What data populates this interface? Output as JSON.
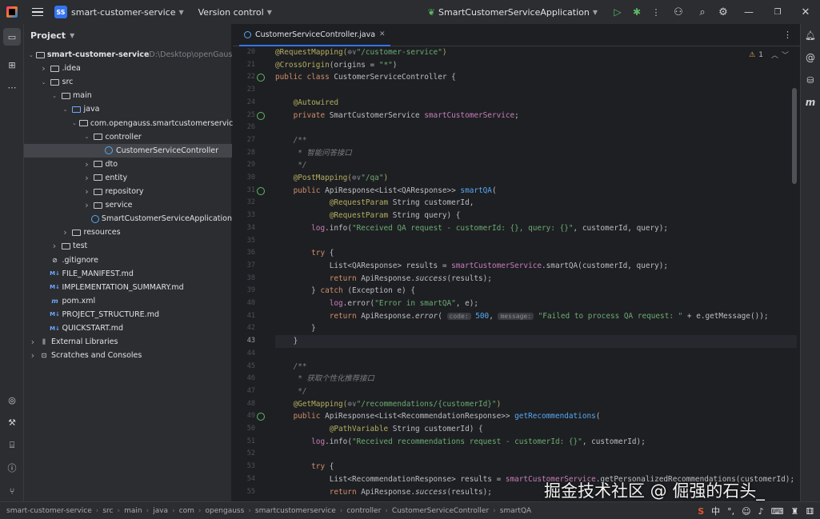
{
  "titlebar": {
    "project_badge": "SS",
    "project_name": "smart-customer-service",
    "vcs": "Version control",
    "run_config": "SmartCustomerServiceApplication"
  },
  "panel": {
    "title": "Project"
  },
  "tree": [
    {
      "depth": 0,
      "arrow": "open",
      "icon": "folder",
      "label": "smart-customer-service",
      "extra": "D:\\Desktop\\openGauss",
      "bold": true
    },
    {
      "depth": 1,
      "arrow": "closed",
      "icon": "folder",
      "label": ".idea"
    },
    {
      "depth": 1,
      "arrow": "open",
      "icon": "folder",
      "label": "src"
    },
    {
      "depth": 2,
      "arrow": "open",
      "icon": "folder",
      "label": "main"
    },
    {
      "depth": 3,
      "arrow": "open",
      "icon": "folder-blue",
      "label": "java"
    },
    {
      "depth": 4,
      "arrow": "open",
      "icon": "folder",
      "label": "com.opengauss.smartcustomerservice"
    },
    {
      "depth": 5,
      "arrow": "open",
      "icon": "folder",
      "label": "controller"
    },
    {
      "depth": 6,
      "arrow": "none",
      "icon": "class",
      "label": "CustomerServiceController",
      "selected": true
    },
    {
      "depth": 5,
      "arrow": "closed",
      "icon": "folder",
      "label": "dto"
    },
    {
      "depth": 5,
      "arrow": "closed",
      "icon": "folder",
      "label": "entity"
    },
    {
      "depth": 5,
      "arrow": "closed",
      "icon": "folder",
      "label": "repository"
    },
    {
      "depth": 5,
      "arrow": "closed",
      "icon": "folder",
      "label": "service"
    },
    {
      "depth": 5,
      "arrow": "none",
      "icon": "class",
      "label": "SmartCustomerServiceApplication"
    },
    {
      "depth": 3,
      "arrow": "closed",
      "icon": "folder",
      "label": "resources"
    },
    {
      "depth": 2,
      "arrow": "closed",
      "icon": "folder",
      "label": "test"
    },
    {
      "depth": 1,
      "arrow": "none",
      "icon": "git",
      "label": ".gitignore"
    },
    {
      "depth": 1,
      "arrow": "none",
      "icon": "md",
      "label": "FILE_MANIFEST.md"
    },
    {
      "depth": 1,
      "arrow": "none",
      "icon": "md",
      "label": "IMPLEMENTATION_SUMMARY.md"
    },
    {
      "depth": 1,
      "arrow": "none",
      "icon": "maven",
      "label": "pom.xml"
    },
    {
      "depth": 1,
      "arrow": "none",
      "icon": "md",
      "label": "PROJECT_STRUCTURE.md"
    },
    {
      "depth": 1,
      "arrow": "none",
      "icon": "md",
      "label": "QUICKSTART.md"
    },
    {
      "depth": 0,
      "arrow": "closed",
      "icon": "lib",
      "label": "External Libraries"
    },
    {
      "depth": 0,
      "arrow": "closed",
      "icon": "scratch",
      "label": "Scratches and Consoles"
    }
  ],
  "editor": {
    "tab_label": "CustomerServiceController.java",
    "warnings": "1"
  },
  "code": [
    {
      "n": "20",
      "t": [
        [
          "an",
          "@RequestMapping("
        ],
        [
          "gray",
          "⊕∨"
        ],
        [
          "st",
          "\"/customer-service\""
        ],
        [
          "an",
          ")"
        ]
      ]
    },
    {
      "n": "21",
      "t": [
        [
          "an",
          "@CrossOrigin"
        ],
        [
          "",
          "(origins = "
        ],
        [
          "st",
          "\"*\""
        ],
        [
          "",
          ")"
        ]
      ]
    },
    {
      "n": "22",
      "g": true,
      "t": [
        [
          "kw",
          "public class "
        ],
        [
          "",
          "CustomerServiceController {"
        ]
      ]
    },
    {
      "n": "23",
      "t": []
    },
    {
      "n": "24",
      "t": [
        [
          "",
          "    "
        ],
        [
          "an",
          "@Autowired"
        ]
      ]
    },
    {
      "n": "25",
      "g": true,
      "t": [
        [
          "",
          "    "
        ],
        [
          "kw",
          "private "
        ],
        [
          "",
          "SmartCustomerService "
        ],
        [
          "fd",
          "smartCustomerService"
        ],
        [
          "",
          ";"
        ]
      ]
    },
    {
      "n": "26",
      "t": []
    },
    {
      "n": "27",
      "t": [
        [
          "cm",
          "    /**"
        ]
      ]
    },
    {
      "n": "28",
      "t": [
        [
          "cm",
          "     * 智能问答接口"
        ]
      ]
    },
    {
      "n": "29",
      "t": [
        [
          "cm",
          "     */"
        ]
      ]
    },
    {
      "n": "30",
      "t": [
        [
          "",
          "    "
        ],
        [
          "an",
          "@PostMapping("
        ],
        [
          "gray",
          "⊕∨"
        ],
        [
          "st",
          "\"/qa\""
        ],
        [
          "an",
          ")"
        ]
      ]
    },
    {
      "n": "31",
      "g": true,
      "t": [
        [
          "",
          "    "
        ],
        [
          "kw",
          "public "
        ],
        [
          "",
          "ApiResponse<List<QAResponse>> "
        ],
        [
          "fn",
          "smartQA"
        ],
        [
          "",
          "("
        ]
      ]
    },
    {
      "n": "32",
      "t": [
        [
          "",
          "            "
        ],
        [
          "an",
          "@RequestParam "
        ],
        [
          "",
          "String customerId,"
        ]
      ]
    },
    {
      "n": "33",
      "t": [
        [
          "",
          "            "
        ],
        [
          "an",
          "@RequestParam "
        ],
        [
          "",
          "String query) {"
        ]
      ]
    },
    {
      "n": "34",
      "t": [
        [
          "",
          "        "
        ],
        [
          "fd",
          "log"
        ],
        [
          "",
          ".info("
        ],
        [
          "st",
          "\"Received QA request - customerId: {}, query: {}\""
        ],
        [
          "",
          ", customerId, query);"
        ]
      ]
    },
    {
      "n": "35",
      "t": []
    },
    {
      "n": "36",
      "t": [
        [
          "",
          "        "
        ],
        [
          "kw",
          "try "
        ],
        [
          "",
          "{"
        ]
      ]
    },
    {
      "n": "37",
      "t": [
        [
          "",
          "            List<QAResponse> results = "
        ],
        [
          "fd",
          "smartCustomerService"
        ],
        [
          "",
          ".smartQA(customerId, query);"
        ]
      ]
    },
    {
      "n": "38",
      "t": [
        [
          "",
          "            "
        ],
        [
          "kw",
          "return "
        ],
        [
          "",
          "ApiResponse."
        ],
        [
          "it",
          "success"
        ],
        [
          "",
          "(results);"
        ]
      ]
    },
    {
      "n": "39",
      "t": [
        [
          "",
          "        } "
        ],
        [
          "kw",
          "catch "
        ],
        [
          "",
          "(Exception e) {"
        ]
      ]
    },
    {
      "n": "40",
      "t": [
        [
          "",
          "            "
        ],
        [
          "fd",
          "log"
        ],
        [
          "",
          ".error("
        ],
        [
          "st",
          "\"Error in smartQA\""
        ],
        [
          "",
          ", e);"
        ]
      ]
    },
    {
      "n": "41",
      "t": [
        [
          "",
          "            "
        ],
        [
          "kw",
          "return "
        ],
        [
          "",
          "ApiResponse."
        ],
        [
          "it",
          "error"
        ],
        [
          "",
          "( "
        ],
        [
          "hint",
          "code:"
        ],
        [
          "fn",
          " 500"
        ],
        [
          "",
          ", "
        ],
        [
          "hint",
          "message:"
        ],
        [
          "st",
          " \"Failed to process QA request: \""
        ],
        [
          "",
          " + e.getMessage());"
        ]
      ]
    },
    {
      "n": "42",
      "t": [
        [
          "",
          "        }"
        ]
      ]
    },
    {
      "n": "43",
      "cur": true,
      "t": [
        [
          "",
          "    }"
        ]
      ]
    },
    {
      "n": "44",
      "t": []
    },
    {
      "n": "45",
      "t": [
        [
          "cm",
          "    /**"
        ]
      ]
    },
    {
      "n": "46",
      "t": [
        [
          "cm",
          "     * 获取个性化推荐接口"
        ]
      ]
    },
    {
      "n": "47",
      "t": [
        [
          "cm",
          "     */"
        ]
      ]
    },
    {
      "n": "48",
      "t": [
        [
          "",
          "    "
        ],
        [
          "an",
          "@GetMapping("
        ],
        [
          "gray",
          "⊕∨"
        ],
        [
          "st",
          "\"/recommendations/{customerId}\""
        ],
        [
          "an",
          ")"
        ]
      ]
    },
    {
      "n": "49",
      "g": true,
      "t": [
        [
          "",
          "    "
        ],
        [
          "kw",
          "public "
        ],
        [
          "",
          "ApiResponse<List<RecommendationResponse>> "
        ],
        [
          "fn",
          "getRecommendations"
        ],
        [
          "",
          "("
        ]
      ]
    },
    {
      "n": "50",
      "t": [
        [
          "",
          "            "
        ],
        [
          "an",
          "@PathVariable "
        ],
        [
          "",
          "String customerId) {"
        ]
      ]
    },
    {
      "n": "51",
      "t": [
        [
          "",
          "        "
        ],
        [
          "fd",
          "log"
        ],
        [
          "",
          ".info("
        ],
        [
          "st",
          "\"Received recommendations request - customerId: {}\""
        ],
        [
          "",
          ", customerId);"
        ]
      ]
    },
    {
      "n": "52",
      "t": []
    },
    {
      "n": "53",
      "t": [
        [
          "",
          "        "
        ],
        [
          "kw",
          "try "
        ],
        [
          "",
          "{"
        ]
      ]
    },
    {
      "n": "54",
      "t": [
        [
          "",
          "            List<RecommendationResponse> results = "
        ],
        [
          "fd",
          "smartCustomerService"
        ],
        [
          "",
          ".getPersonalizedRecommendations(customerId);"
        ]
      ]
    },
    {
      "n": "55",
      "t": [
        [
          "",
          "            "
        ],
        [
          "kw",
          "return "
        ],
        [
          "",
          "ApiResponse."
        ],
        [
          "it",
          "success"
        ],
        [
          "",
          "(results);"
        ]
      ]
    }
  ],
  "breadcrumb": [
    "smart-customer-service",
    "src",
    "main",
    "java",
    "com",
    "opengauss",
    "smartcustomerservice",
    "controller",
    "CustomerServiceController",
    "smartQA"
  ],
  "watermark": "掘金技术社区 @ 倔强的石头_",
  "status_ime": "中"
}
